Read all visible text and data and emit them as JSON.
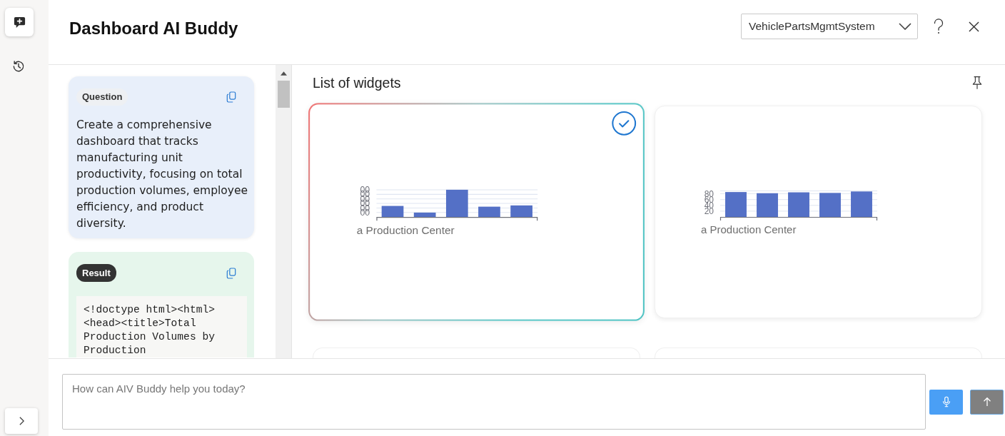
{
  "header": {
    "title": "Dashboard AI Buddy",
    "dataset_dropdown": {
      "value": "VehiclePartsMgmtSystem"
    }
  },
  "chat": {
    "messages": [
      {
        "kind": "question",
        "label": "Question",
        "text": "Create a comprehensive dashboard that tracks manufacturing unit productivity, focusing on total production volumes, employee efficiency, and product diversity."
      },
      {
        "kind": "result",
        "label": "Result",
        "text": "<!doctype html><html><head><title>Total Production Volumes by Production"
      }
    ]
  },
  "widgets_panel": {
    "title": "List of widgets",
    "widgets": [
      {
        "kind": "preview",
        "selected": true,
        "y_tick_labels": [
          "00",
          "00",
          "00",
          "00",
          "00",
          "00"
        ],
        "x_label": "a Production Center"
      },
      {
        "kind": "chart",
        "selected": false,
        "chart_data": {
          "type": "bar",
          "xlabel": "a Production Center",
          "ylim": [
            0,
            90
          ],
          "yticks": [
            20,
            40,
            60,
            80
          ],
          "grid": true,
          "values": [
            86,
            82,
            85,
            83,
            88
          ]
        }
      },
      {
        "kind": "clipped",
        "selected": false
      },
      {
        "kind": "clipped",
        "selected": false
      }
    ]
  },
  "composer": {
    "placeholder": "How can AIV Buddy help you today?"
  }
}
